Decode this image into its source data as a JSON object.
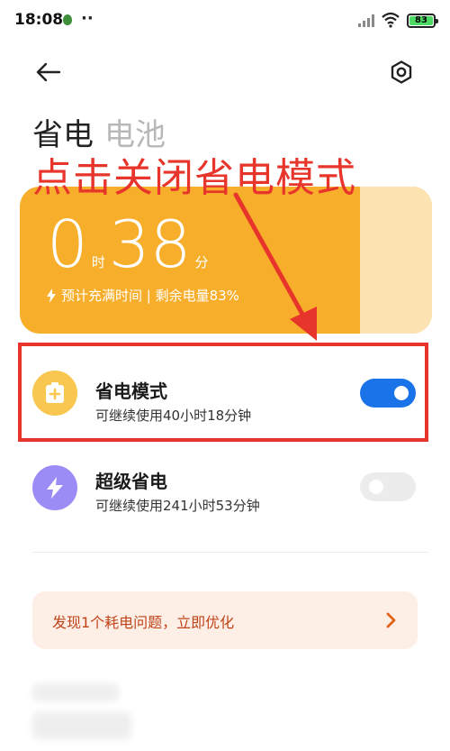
{
  "status_bar": {
    "time": "18:08",
    "dots": "··",
    "battery_level": "83"
  },
  "tabs": [
    {
      "label": "省电",
      "active": true
    },
    {
      "label": "电池",
      "active": false
    }
  ],
  "annotation": "点击关闭省电模式",
  "battery_card": {
    "hours": "0",
    "hours_unit": "时",
    "minutes": "38",
    "minutes_unit": "分",
    "charge_info": "预计充满时间 | 剩余电量83%",
    "charge_level_percent": 83
  },
  "modes": [
    {
      "title": "省电模式",
      "subtitle": "可继续使用40小时18分钟",
      "enabled": true,
      "icon": "battery-plus-icon"
    },
    {
      "title": "超级省电",
      "subtitle": "可继续使用241小时53分钟",
      "enabled": false,
      "icon": "lightning-icon"
    }
  ],
  "promo": {
    "text": "发现1个耗电问题，立即优化"
  },
  "colors": {
    "card_orange": "#f7ae2b",
    "toggle_blue": "#1a73e8",
    "annotation_red": "#e8352b",
    "power_save_icon_bg": "#f9c74f",
    "super_save_icon_bg": "#9b8cf5"
  }
}
